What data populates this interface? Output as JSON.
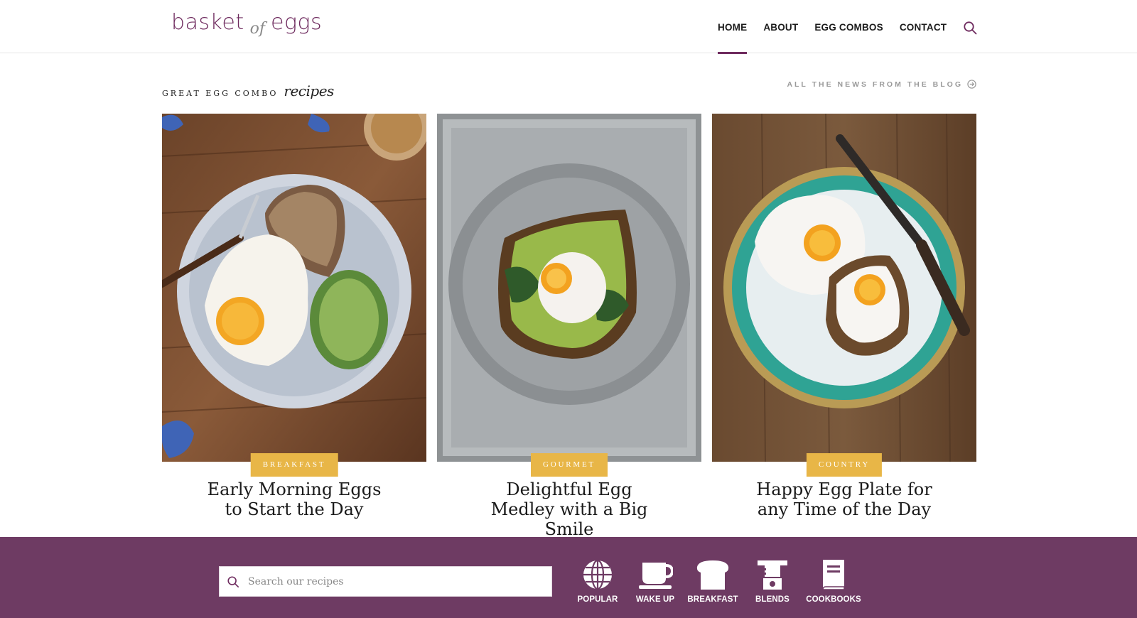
{
  "colors": {
    "brand": "#6e2a5e",
    "footer": "#6e3b63",
    "badge": "#e8b647"
  },
  "logo": {
    "word1": "basket",
    "word2": "of",
    "word3": "eggs"
  },
  "nav": {
    "items": [
      "HOME",
      "ABOUT",
      "EGG COMBOS",
      "CONTACT"
    ],
    "active": "HOME"
  },
  "section": {
    "title_caps": "GREAT EGG COMBO",
    "title_script": "recipes",
    "blog_link": "ALL THE NEWS FROM THE BLOG"
  },
  "cards": [
    {
      "category": "BREAKFAST",
      "title": "Early Morning Eggs to Start the Day"
    },
    {
      "category": "GOURMET",
      "title": "Delightful Egg Medley with a Big Smile"
    },
    {
      "category": "COUNTRY",
      "title": "Happy Egg Plate for any Time of the Day"
    }
  ],
  "footer": {
    "search_placeholder": "Search our recipes",
    "categories": [
      {
        "label": "POPULAR",
        "icon": "globe-icon"
      },
      {
        "label": "WAKE UP",
        "icon": "coffee-cup-icon"
      },
      {
        "label": "BREAKFAST",
        "icon": "bread-icon"
      },
      {
        "label": "BLENDS",
        "icon": "blender-icon"
      },
      {
        "label": "COOKBOOKS",
        "icon": "book-icon"
      }
    ]
  }
}
